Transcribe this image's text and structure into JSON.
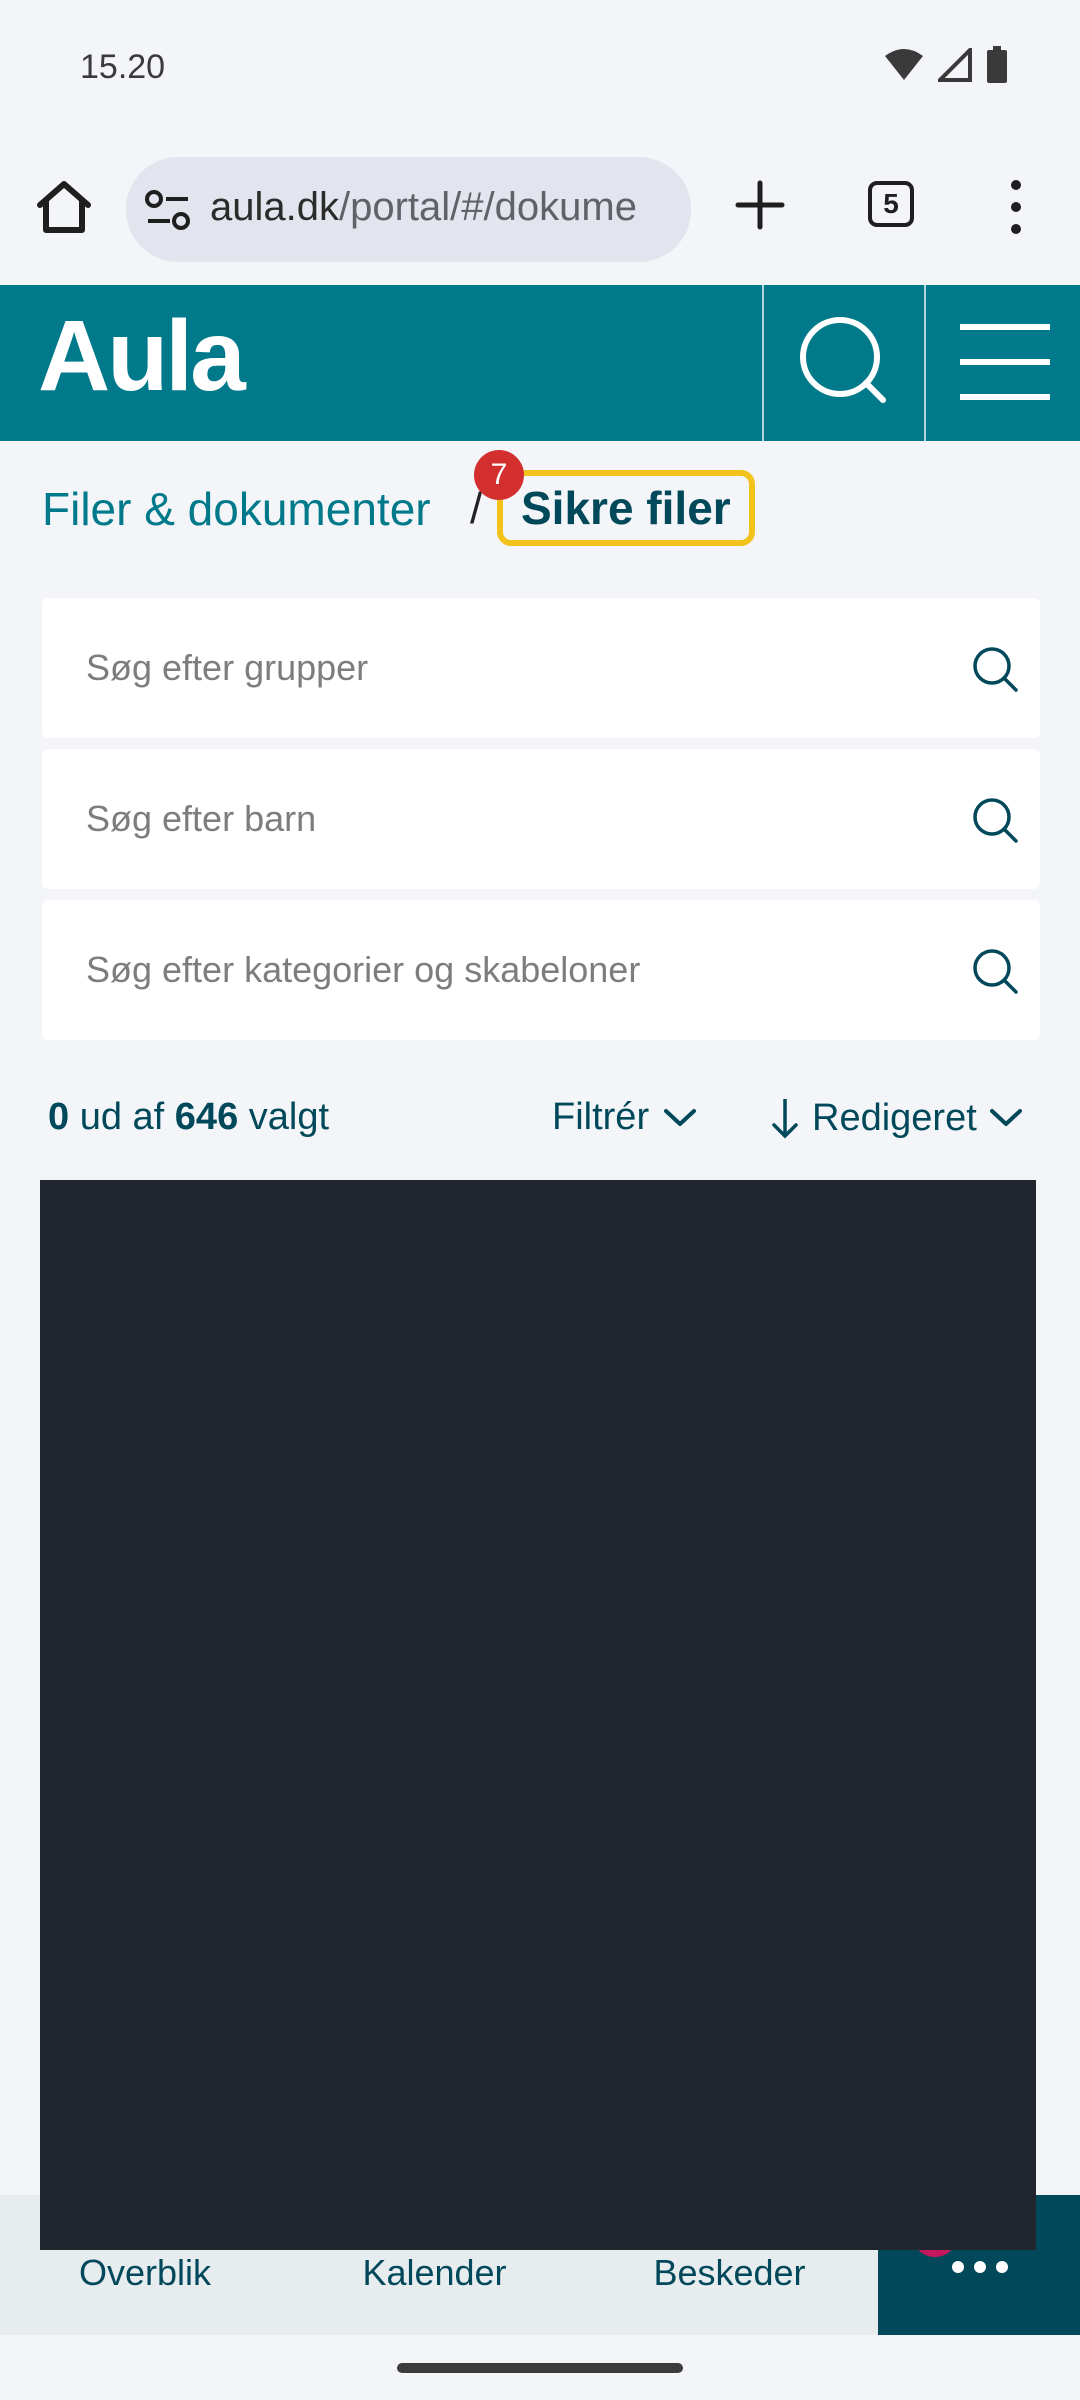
{
  "status_bar": {
    "time": "15.20",
    "icons": [
      "wifi-icon",
      "signal-icon",
      "battery-icon"
    ]
  },
  "browser": {
    "url_domain": "aula.dk",
    "url_path": "/portal/#/dokume",
    "tab_count": "5"
  },
  "app": {
    "logo": "Aula",
    "brand_color": "#007a8a"
  },
  "breadcrumb": {
    "parent": "Filer & dokumenter",
    "separator": "/",
    "current": "Sikre filer",
    "badge": "7"
  },
  "search": {
    "groups_placeholder": "Søg efter grupper",
    "children_placeholder": "Søg efter barn",
    "categories_placeholder": "Søg efter kategorier og skabeloner"
  },
  "list_header": {
    "selected_count": "0",
    "of_text": "ud af",
    "total_count": "646",
    "selected_text": "valgt",
    "filter_label": "Filtrér",
    "sort_label": "Redigeret"
  },
  "bottom_nav": {
    "items": [
      {
        "label": "Overblik",
        "icon": "overview-icon"
      },
      {
        "label": "Kalender",
        "icon": "calendar-icon"
      },
      {
        "label": "Beskeder",
        "icon": "messages-icon"
      }
    ],
    "more_icon": "more-dots-icon"
  }
}
